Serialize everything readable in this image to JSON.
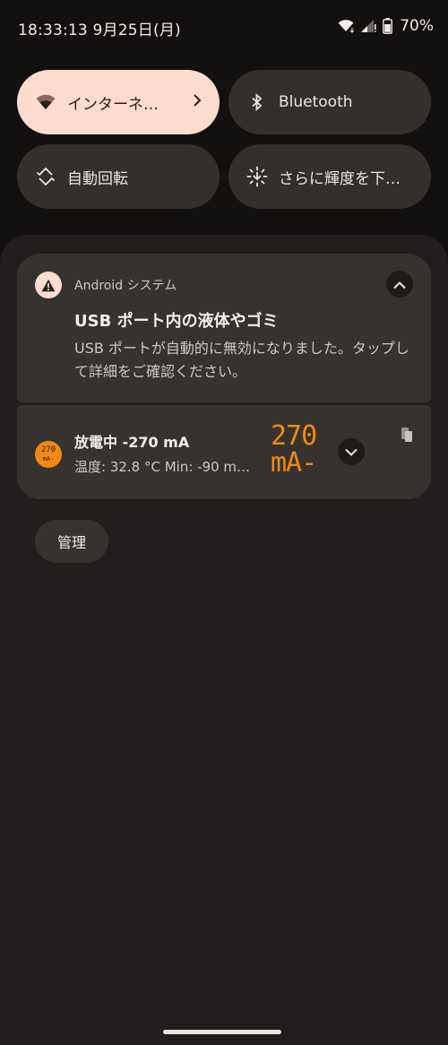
{
  "status_bar": {
    "time": "18:33:13 9月25日(月)",
    "battery_percent": "70%",
    "battery_level": 0.7,
    "icons": [
      "wifi-icon",
      "signal-icon",
      "battery-icon"
    ]
  },
  "quick_settings": {
    "tiles": [
      {
        "label": "インターネ…",
        "icon": "wifi-icon",
        "active": true,
        "has_chevron": true
      },
      {
        "label": "Bluetooth",
        "icon": "bluetooth-icon",
        "active": false
      },
      {
        "label": "自動回転",
        "icon": "auto-rotate-icon",
        "active": false
      },
      {
        "label": "さらに輝度を下…",
        "icon": "extra-dim-icon",
        "active": false
      }
    ]
  },
  "notifications": [
    {
      "app": "Android システム",
      "icon": "warning-icon",
      "title": "USB ポート内の液体やゴミ",
      "body": "USB ポートが自動的に無効になりました。タップして詳細をご確認ください。"
    },
    {
      "icon_text_line1": "270",
      "icon_text_line2": "mA-",
      "title": "放電中 -270 mA",
      "subtitle": "温度: 32.8 °C  Min: -90 m…",
      "big_value_line1": "270",
      "big_value_line2": "mA-"
    }
  ],
  "manage_button": "管理",
  "colors": {
    "background": "#131110",
    "shade": "#211e1d",
    "card": "#363230",
    "active_tile": "#fbdccf",
    "accent_orange": "#f08a12"
  }
}
